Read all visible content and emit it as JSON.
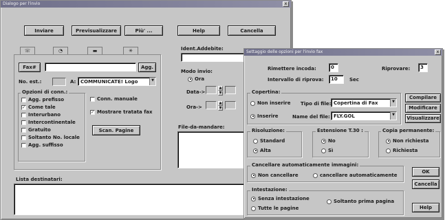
{
  "main_window": {
    "title": "Dialogo per l'invio",
    "close_glyph": "x",
    "toolbar": {
      "send": "Inviare",
      "preview": "Previsualizzare",
      "more": "Più' ...",
      "help": "Help",
      "cancel": "Cancella"
    },
    "tabs": [
      "tab-1",
      "tab-2",
      "tab-3",
      "tab-4"
    ],
    "fax_label": "Fax#",
    "add_button": "Agg.",
    "no_est_label": "No. est.:",
    "a_label": "A:",
    "recipient_select": "COMMUNICATE! Logo",
    "conn_options_title": "Opzioni di conn.:",
    "conn_options": [
      {
        "label": "Agg. prefisso",
        "checked": false
      },
      {
        "label": "Come tale",
        "checked": true
      },
      {
        "label": "Interurbano",
        "checked": false
      },
      {
        "label": "Intercontinentale",
        "checked": false
      },
      {
        "label": "Gratuito",
        "checked": false
      },
      {
        "label": "Soltanto No. locale",
        "checked": false
      },
      {
        "label": "Agg. suffisso",
        "checked": false
      }
    ],
    "manual_conn": {
      "label": "Conn. manuale",
      "checked": false
    },
    "show_fax_dialed": {
      "label": "Mostrare tratata fax",
      "checked": true
    },
    "scan_pages": "Scan. Pagine",
    "ident_label": "Ident.Addebite:",
    "send_mode_label": "Modo invio:",
    "send_mode_now": "Ora",
    "date_label": "Data->",
    "time_label": "Ora->",
    "files_label": "File-da-mandare:",
    "recipients_list_label": "Lista destinatari:"
  },
  "options_dialog": {
    "title": "Settaggio delle opzioni per l'invio fax",
    "close_glyph": "x",
    "retry_busy_label": "Rimettere incoda:",
    "retry_busy_value": "0",
    "retry_label": "Riprovare:",
    "retry_value": "3",
    "retry_interval_label": "Intervallo di riprova:",
    "retry_interval_value": "10",
    "sec_label": "Sec",
    "cover_title": "Copertina:",
    "cover_no_insert": "Non inserire",
    "cover_insert": "Inserire",
    "file_type_label": "Tipo di file:",
    "file_type_value": "Copertina di Fax",
    "file_name_label": "Name del file:",
    "file_name_value": "FLY.GOL",
    "compile_button": "Compilare",
    "modify_button": "Modificare",
    "view_button": "Visualizzare",
    "resolution_title": "Risoluzione:",
    "res_standard": "Standard",
    "res_high": "Alta",
    "ext_title": "Estensione T.30 :",
    "ext_no": "No",
    "ext_yes": "Sì",
    "perm_copy_title": "Copia permanente:",
    "perm_not_required": "Non richiesta",
    "perm_required": "Richiesta",
    "auto_delete_title": "Cancellare automaticamente immagini:",
    "auto_delete_no": "Non cancellare",
    "auto_delete_yes": "cancellare automaticamente",
    "header_title": "Intestazione:",
    "header_none": "Senza intestazione",
    "header_all": "Tutte le pagine",
    "header_first": "Soltanto prima pagina",
    "ok_button": "OK",
    "cancel_button": "Cancella",
    "help_button": "Help"
  }
}
